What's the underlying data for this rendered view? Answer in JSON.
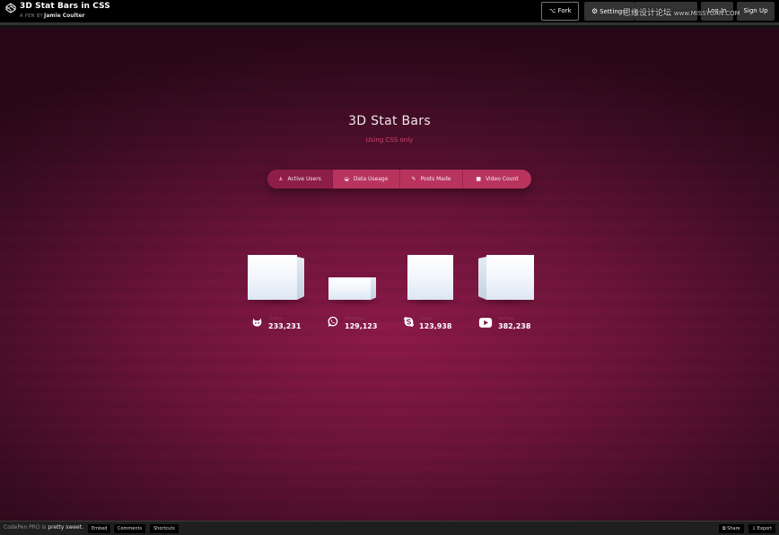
{
  "header": {
    "title": "3D Stat Bars in CSS",
    "pen_by": "A PEN BY",
    "author": "Jamie Coulter",
    "buttons": {
      "fork": "⌥ Fork",
      "settings": "Settings",
      "login": "Log In",
      "signup": "Sign Up"
    },
    "watermark_main": "思缘设计论坛",
    "watermark_site": "www.MISSYUAN.COM"
  },
  "page": {
    "title": "3D Stat Bars",
    "subtitle": "Using CSS only"
  },
  "tabs": [
    {
      "label": "Active Users",
      "icon": "user-icon",
      "active": true
    },
    {
      "label": "Data Useage",
      "icon": "pie-icon",
      "active": false
    },
    {
      "label": "Posts Made",
      "icon": "edit-icon",
      "active": false
    },
    {
      "label": "Video Count",
      "icon": "video-icon",
      "active": false
    }
  ],
  "stats": [
    {
      "icon": "github-icon",
      "label": "GitHub",
      "value": "233,231"
    },
    {
      "icon": "whatsapp-icon",
      "label": "WhatsApp",
      "value": "129,123"
    },
    {
      "icon": "skype-icon",
      "label": "Skype",
      "value": "123,938"
    },
    {
      "icon": "youtube-icon",
      "label": "YouTube",
      "value": "382,238"
    }
  ],
  "footer": {
    "brand": "CodePen PRO is",
    "brand_tail": "pretty sweet.",
    "embed": "Embed",
    "comments": "Comments",
    "shortcuts": "Shortcuts",
    "share": "⧉ Share",
    "export": "⇩ Export"
  },
  "colors": {
    "background": "#6c1439",
    "tab_bar": "#b8345f",
    "tab_active": "#8c1e47",
    "subtitle": "#c8456f"
  }
}
